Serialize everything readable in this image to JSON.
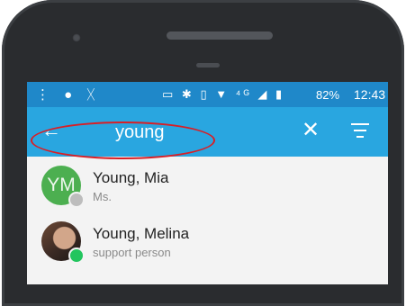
{
  "status_bar": {
    "left_icons": [
      "notification-icon",
      "android-icon",
      "missed-call-icon"
    ],
    "right_icons": [
      "cast-icon",
      "bluetooth-icon",
      "vibrate-icon",
      "wifi-icon",
      "lte-icon",
      "signal-icon",
      "battery-icon"
    ],
    "battery": "82%",
    "time": "12:43"
  },
  "toolbar": {
    "search_value": "young",
    "accent_color": "#29a6e0",
    "status_color": "#1f88c9"
  },
  "contacts": [
    {
      "initials": "YM",
      "name": "Young, Mia",
      "subtitle": "Ms.",
      "presence_color": "#bdbdbd",
      "avatar_color": "#4caf50"
    },
    {
      "initials": "",
      "name": "Young, Melina",
      "subtitle": "support person",
      "presence_color": "#22c55e"
    }
  ],
  "annotation": {
    "highlight_color": "#d81f26"
  }
}
